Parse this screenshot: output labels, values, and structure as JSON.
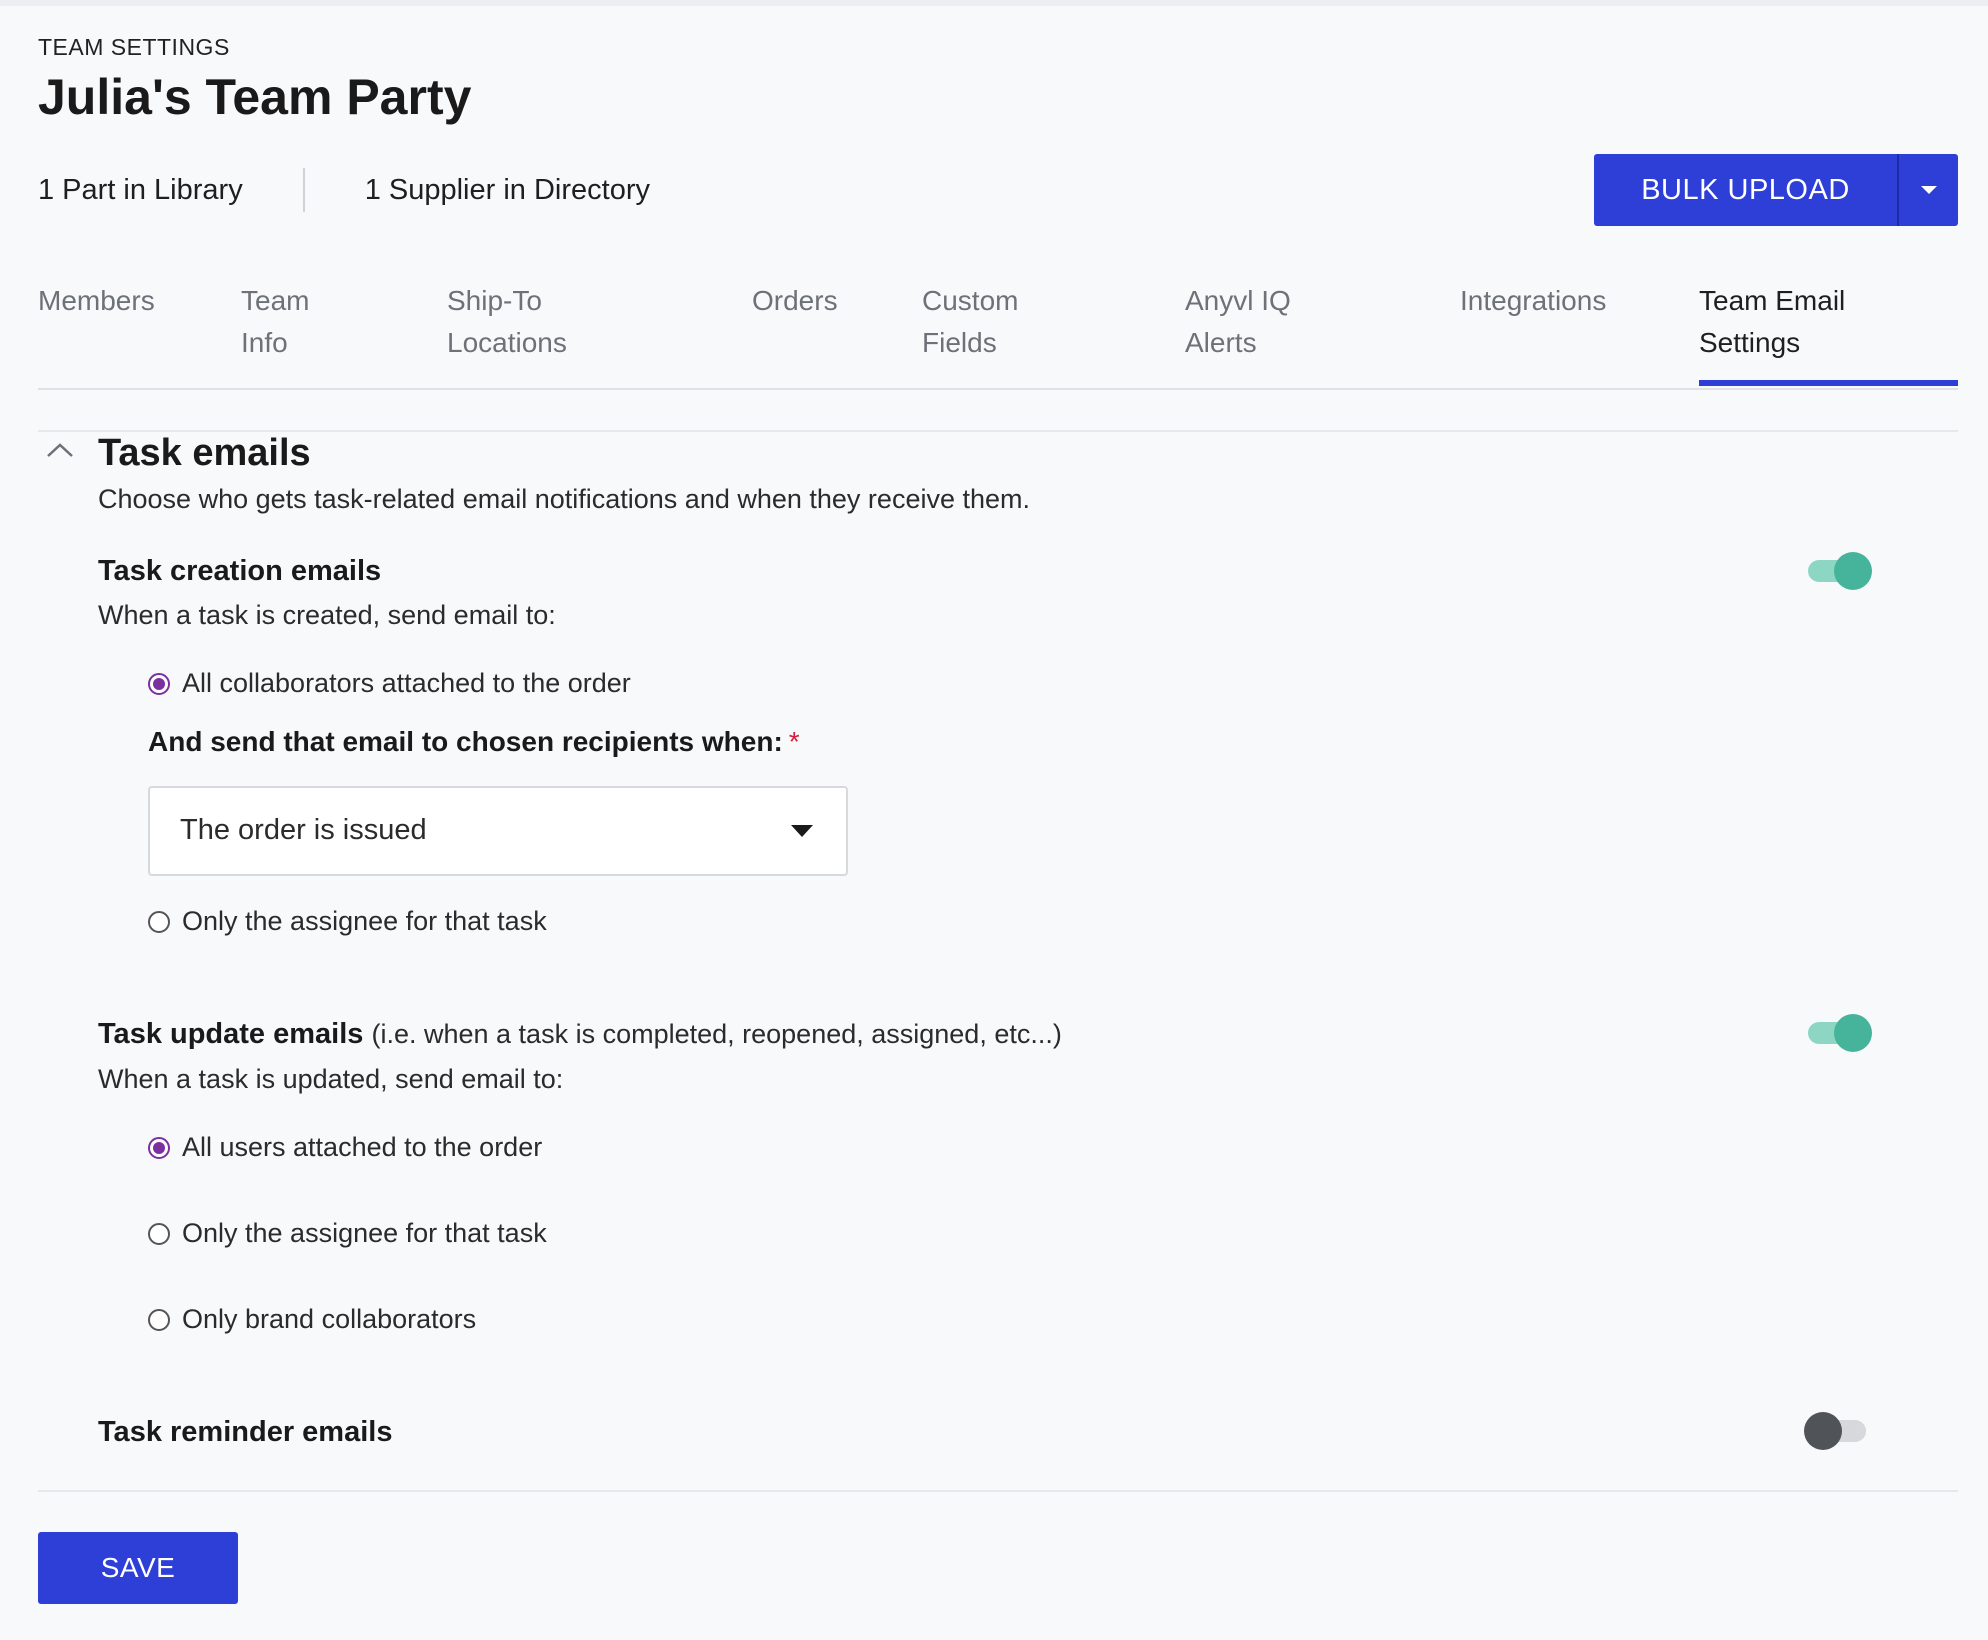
{
  "header": {
    "eyebrow": "TEAM SETTINGS",
    "title": "Julia's Team Party",
    "stats": [
      "1 Part in Library",
      "1 Supplier in Directory"
    ],
    "bulk_upload_label": "BULK UPLOAD"
  },
  "tabs": [
    {
      "line1": "Members",
      "line2": "",
      "active": false
    },
    {
      "line1": "Team",
      "line2": "Info",
      "active": false
    },
    {
      "line1": "Ship-To",
      "line2": "Locations",
      "active": false
    },
    {
      "line1": "Orders",
      "line2": "",
      "active": false
    },
    {
      "line1": "Custom",
      "line2": "Fields",
      "active": false
    },
    {
      "line1": "Anyvl IQ",
      "line2": "Alerts",
      "active": false
    },
    {
      "line1": "Integrations",
      "line2": "",
      "active": false
    },
    {
      "line1": "Team Email",
      "line2": "Settings",
      "active": true
    }
  ],
  "section": {
    "title": "Task emails",
    "description": "Choose who gets task-related email notifications and when they receive them."
  },
  "task_creation": {
    "title": "Task creation emails",
    "subtitle": "When a task is created, send email to:",
    "enabled": true,
    "options": [
      {
        "label": "All collaborators attached to the order",
        "selected": true
      },
      {
        "label": "Only the assignee for that task",
        "selected": false
      }
    ],
    "when_label": "And send that email to chosen recipients when:",
    "required_mark": "*",
    "when_value": "The order is issued"
  },
  "task_update": {
    "title": "Task update emails",
    "title_note": "(i.e. when a task is completed, reopened, assigned, etc...)",
    "subtitle": "When a task is updated, send email to:",
    "enabled": true,
    "options": [
      {
        "label": "All users attached to the order",
        "selected": true
      },
      {
        "label": "Only the assignee for that task",
        "selected": false
      },
      {
        "label": "Only brand collaborators",
        "selected": false
      }
    ]
  },
  "task_reminder": {
    "title": "Task reminder emails",
    "enabled": false
  },
  "footer": {
    "save_label": "SAVE"
  },
  "colors": {
    "primary": "#2e3fd8",
    "toggle_on": "#46b49a",
    "radio_selected": "#7b2fa0",
    "required": "#d21f3c"
  }
}
